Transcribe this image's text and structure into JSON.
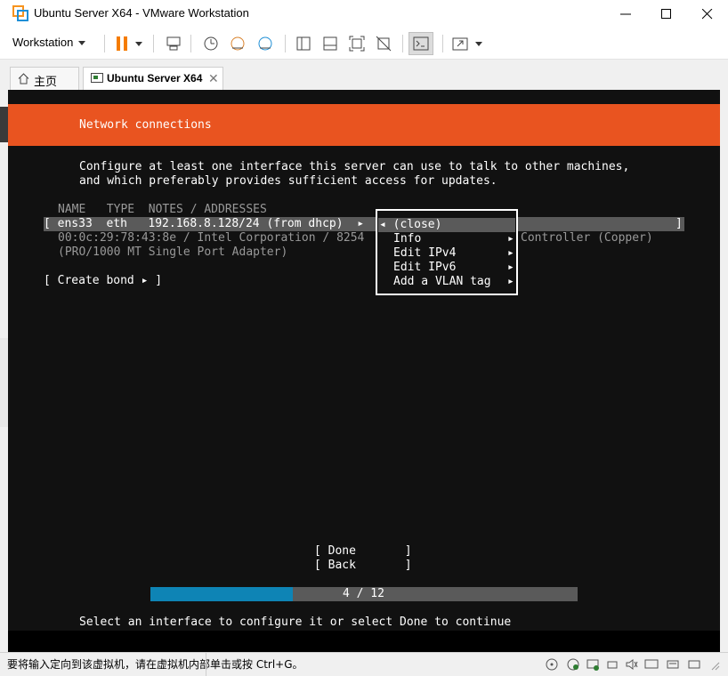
{
  "window": {
    "title": "Ubuntu Server X64 - VMware Workstation"
  },
  "toolbar": {
    "menu_label": "Workstation",
    "icons": [
      "pause-icon",
      "send-keys-icon",
      "snapshot-icon",
      "revert-snapshot-icon",
      "snapshot-manager-icon",
      "library-icon",
      "console-view-icon",
      "fullscreen-icon",
      "unity-icon",
      "terminal-icon",
      "stretch-icon"
    ]
  },
  "tabs": [
    {
      "label": "主页"
    },
    {
      "label": "Ubuntu Server X64",
      "close": "✕"
    }
  ],
  "installer": {
    "header_title": "Network connections",
    "intro_line1": "Configure at least one interface this server can use to talk to other machines,",
    "intro_line2": "and which preferably provides sufficient access for updates.",
    "columns_header": "NAME   TYPE  NOTES / ADDRESSES",
    "interface_row": "[ ens33  eth   192.168.8.128/24 (from dhcp)  ▸",
    "interface_row_end": "]",
    "interface_detail_1a": "00:0c:29:78:43:8e / Intel Corporation / 8254",
    "interface_detail_1b": "Controller (Copper)",
    "interface_detail_2": "(PRO/1000 MT Single Port Adapter)",
    "create_bond": "[ Create bond ▸ ]",
    "popup": {
      "items": [
        {
          "label": "◂ (close)",
          "arrow": ""
        },
        {
          "label": "Info",
          "arrow": "▸"
        },
        {
          "label": "Edit IPv4",
          "arrow": "▸"
        },
        {
          "label": "Edit IPv6",
          "arrow": "▸"
        },
        {
          "label": "Add a VLAN tag",
          "arrow": "▸"
        }
      ]
    },
    "done_button": "[ Done       ]",
    "back_button": "[ Back       ]",
    "progress": {
      "label": "4 / 12",
      "current": 4,
      "total": 12
    },
    "footer_hint": "Select an interface to configure it or select Done to continue"
  },
  "statusbar": {
    "message": "要将输入定向到该虚拟机，请在虚拟机内部单击或按 Ctrl+G。"
  },
  "colors": {
    "header_orange": "#e95420",
    "progress_blue": "#0e84b5",
    "console_bg": "#111111",
    "highlight_gray": "#5a5a5a"
  }
}
